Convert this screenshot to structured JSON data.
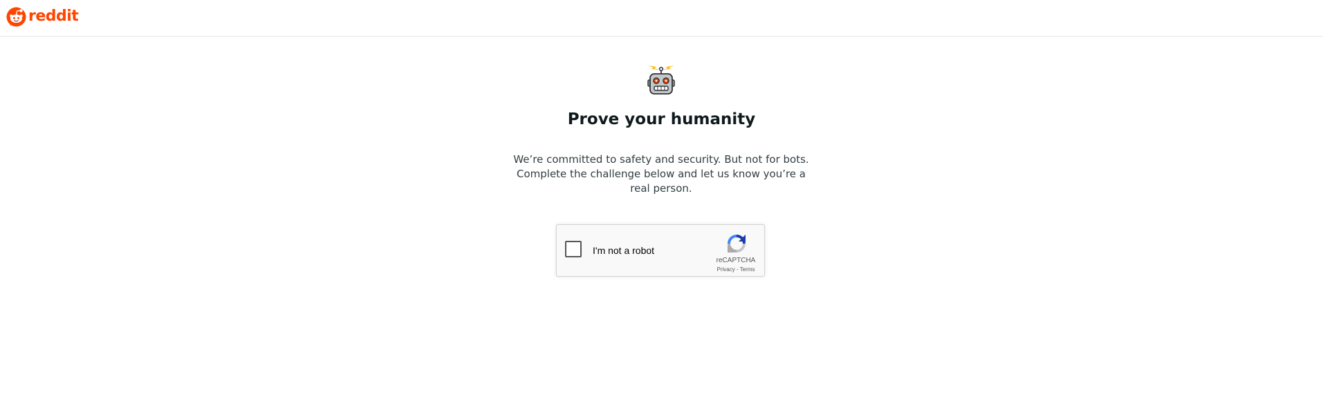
{
  "header": {
    "logo_text": "reddit",
    "logo_icon": "reddit-snoo-icon",
    "brand_color": "#ff4500"
  },
  "main": {
    "illustration_icon": "robot-icon",
    "title": "Prove your humanity",
    "description": "We’re committed to safety and security. But not for bots. Complete the challenge below and let us know you’re a real person."
  },
  "recaptcha": {
    "checkbox_label": "I'm not a robot",
    "brand": "reCAPTCHA",
    "privacy_label": "Privacy",
    "separator": " - ",
    "terms_label": "Terms",
    "logo_icon": "recaptcha-logo-icon"
  }
}
